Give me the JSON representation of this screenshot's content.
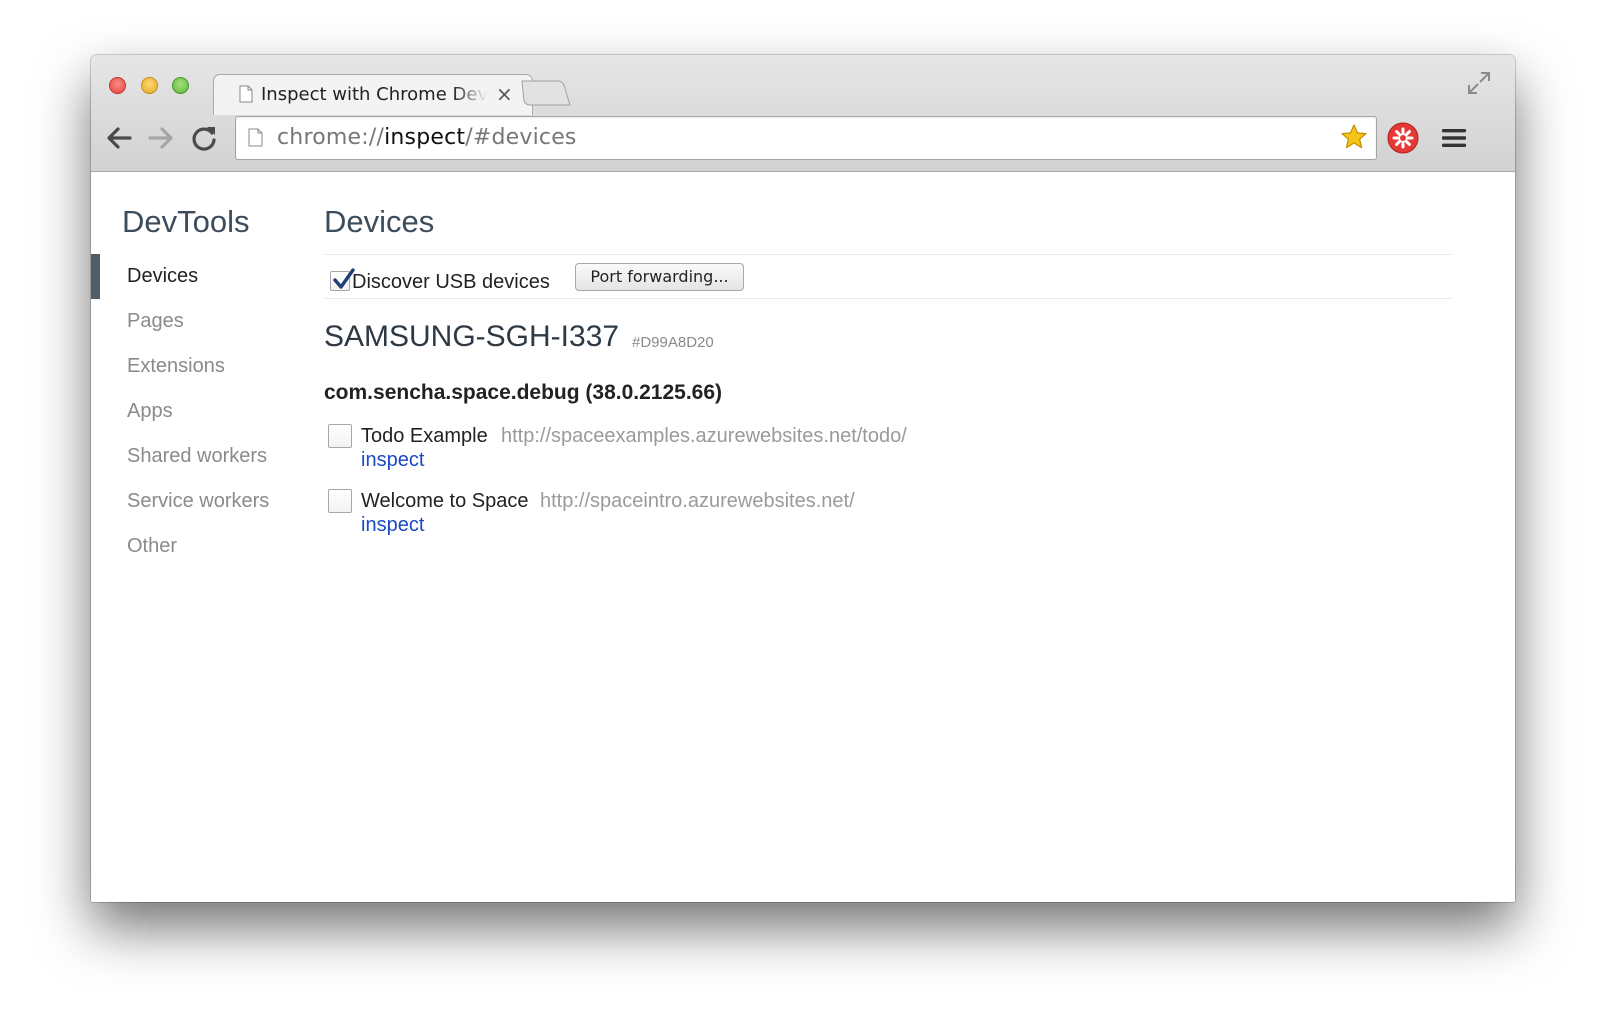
{
  "window": {
    "tab_title": "Inspect with Chrome Developer Tools",
    "tab_close": "×"
  },
  "toolbar": {
    "url_scheme": "chrome://",
    "url_host": "inspect",
    "url_path": "/#devices"
  },
  "sidebar": {
    "title": "DevTools",
    "items": [
      {
        "label": "Devices",
        "selected": true
      },
      {
        "label": "Pages"
      },
      {
        "label": "Extensions"
      },
      {
        "label": "Apps"
      },
      {
        "label": "Shared workers"
      },
      {
        "label": "Service workers"
      },
      {
        "label": "Other"
      }
    ]
  },
  "main": {
    "title": "Devices",
    "discover_usb_label": "Discover USB devices",
    "discover_usb_checked": true,
    "port_forwarding_label": "Port forwarding...",
    "device": {
      "name": "SAMSUNG-SGH-I337",
      "serial": "#D99A8D20",
      "browser": "com.sencha.space.debug (38.0.2125.66)",
      "pages": [
        {
          "title": "Todo Example",
          "url": "http://spaceexamples.azurewebsites.net/todo/",
          "action": "inspect"
        },
        {
          "title": "Welcome to Space",
          "url": "http://spaceintro.azurewebsites.net/",
          "action": "inspect"
        }
      ]
    }
  },
  "icons": {
    "tab": "document-icon",
    "close": "close-icon",
    "new_tab": "new-tab-icon",
    "fullscreen": "fullscreen-icon",
    "back": "back-arrow-icon",
    "forward": "forward-arrow-icon",
    "reload": "reload-icon",
    "page": "page-icon",
    "bookmark": "star-icon",
    "extension": "extension-icon",
    "menu": "hamburger-menu-icon"
  },
  "colors": {
    "link": "#1a49c6",
    "selected_indicator": "#4f5e6b",
    "heading": "#3d4c5a",
    "star": "#f5c518",
    "extension": "#e53935"
  }
}
